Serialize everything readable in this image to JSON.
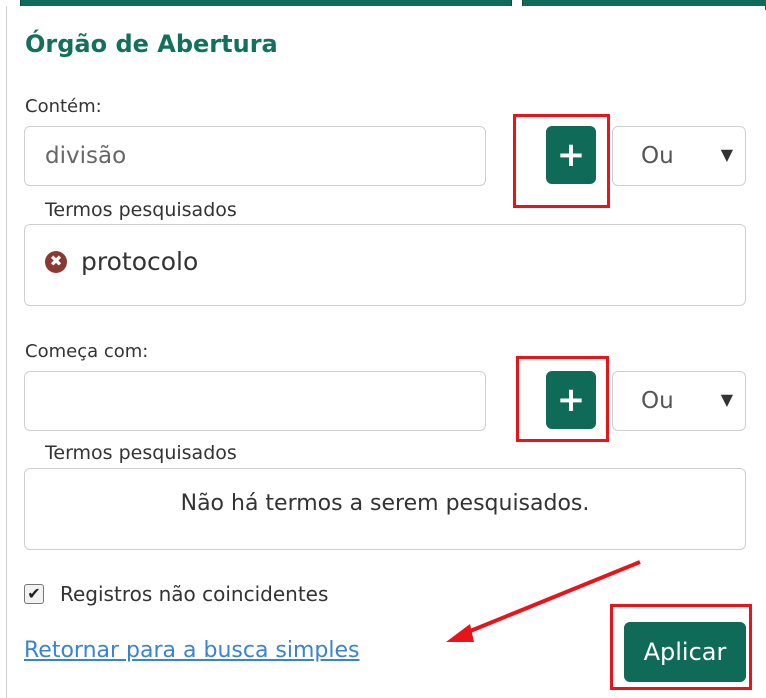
{
  "panel": {
    "title": "Órgão de Abertura"
  },
  "contains": {
    "label": "Contém:",
    "input_value": "divisão",
    "add_symbol": "+",
    "operator_selected": "Ou",
    "terms_label": "Termos pesquisados",
    "terms": [
      {
        "text": "protocolo",
        "remove_symbol": "✖"
      }
    ]
  },
  "starts_with": {
    "label": "Começa com:",
    "input_value": "",
    "add_symbol": "+",
    "operator_selected": "Ou",
    "terms_label": "Termos pesquisados",
    "empty_message": "Não há termos a serem pesquisados."
  },
  "options": {
    "non_matching_label": "Registros não coincidentes",
    "non_matching_checked": true,
    "check_symbol": "✔"
  },
  "footer": {
    "back_link": "Retornar para a busca simples",
    "apply_label": "Aplicar"
  },
  "icons": {
    "add": "plus-icon",
    "remove": "remove-circle-icon",
    "dropdown": "caret-down-icon"
  },
  "colors": {
    "accent": "#0f6b57",
    "title": "#13705b",
    "link": "#3a82d4",
    "annotation": "#e8141c",
    "remove_icon": "#8a3a32"
  }
}
